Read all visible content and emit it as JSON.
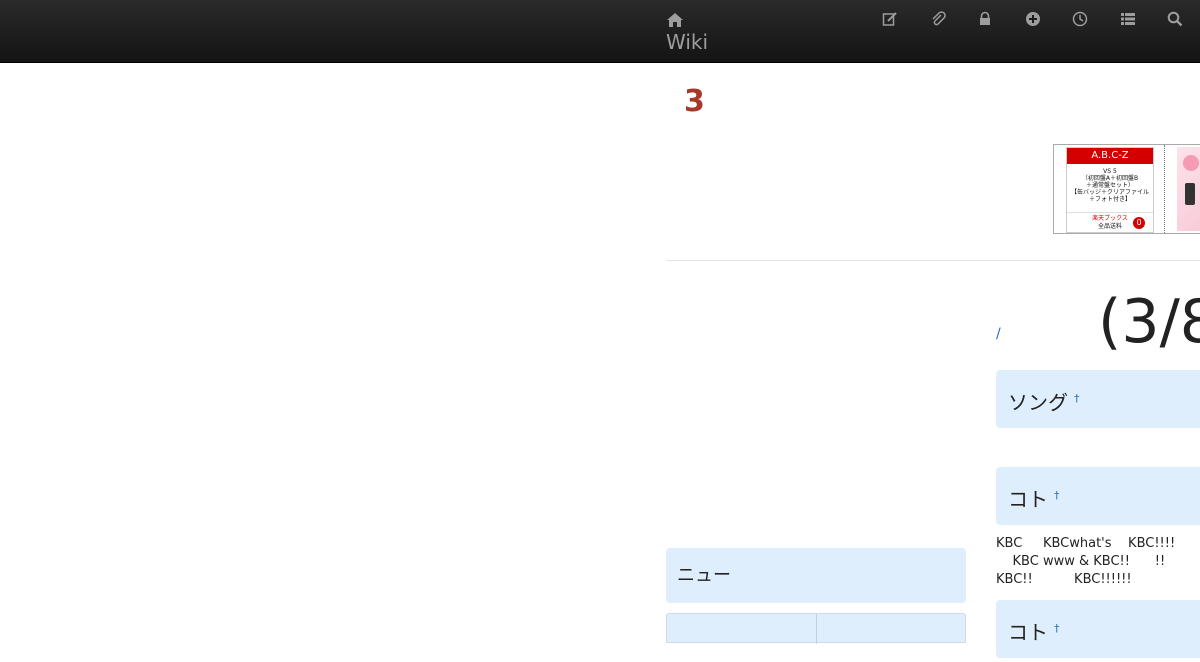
{
  "navbar": {
    "brand_name": "Wiki",
    "brand_icon": "home-icon",
    "tools": [
      {
        "name": "edit-icon"
      },
      {
        "name": "attach-icon"
      },
      {
        "name": "lock-icon"
      },
      {
        "name": "add-icon"
      },
      {
        "name": "history-icon"
      },
      {
        "name": "list-icon"
      },
      {
        "name": "search-icon"
      }
    ],
    "background": "#1b1b1b",
    "text_color": "#9d9d9d"
  },
  "page": {
    "title": "3",
    "title_color": "#a8392a",
    "date_heading": "(3/8",
    "breadcrumb_link": "/"
  },
  "ad": {
    "brand": "A.B.C-Z",
    "description": "VS 5\n（初回盤A＋初回盤B\n＋通常盤セット）\n【缶バッジ＋クリアファイル\n＋フォト付き】",
    "store": "楽天ブックス",
    "shipping": "全品送料",
    "zero": "0"
  },
  "sections": [
    {
      "heading": "ソング",
      "anchor": "†"
    },
    {
      "heading": "コト",
      "anchor": "†"
    },
    {
      "heading": "コト",
      "anchor": "†"
    }
  ],
  "section_text": [
    "KBC     KBCwhat's    KBC!!!!",
    "    KBC www & KBC!!      !!",
    "KBC!!          KBC!!!!!!"
  ],
  "sidebar": {
    "heading": "ニュー"
  },
  "colors": {
    "accent": "#a8392a",
    "link": "#2a6fb8",
    "section_bg": "#dfeefc"
  }
}
